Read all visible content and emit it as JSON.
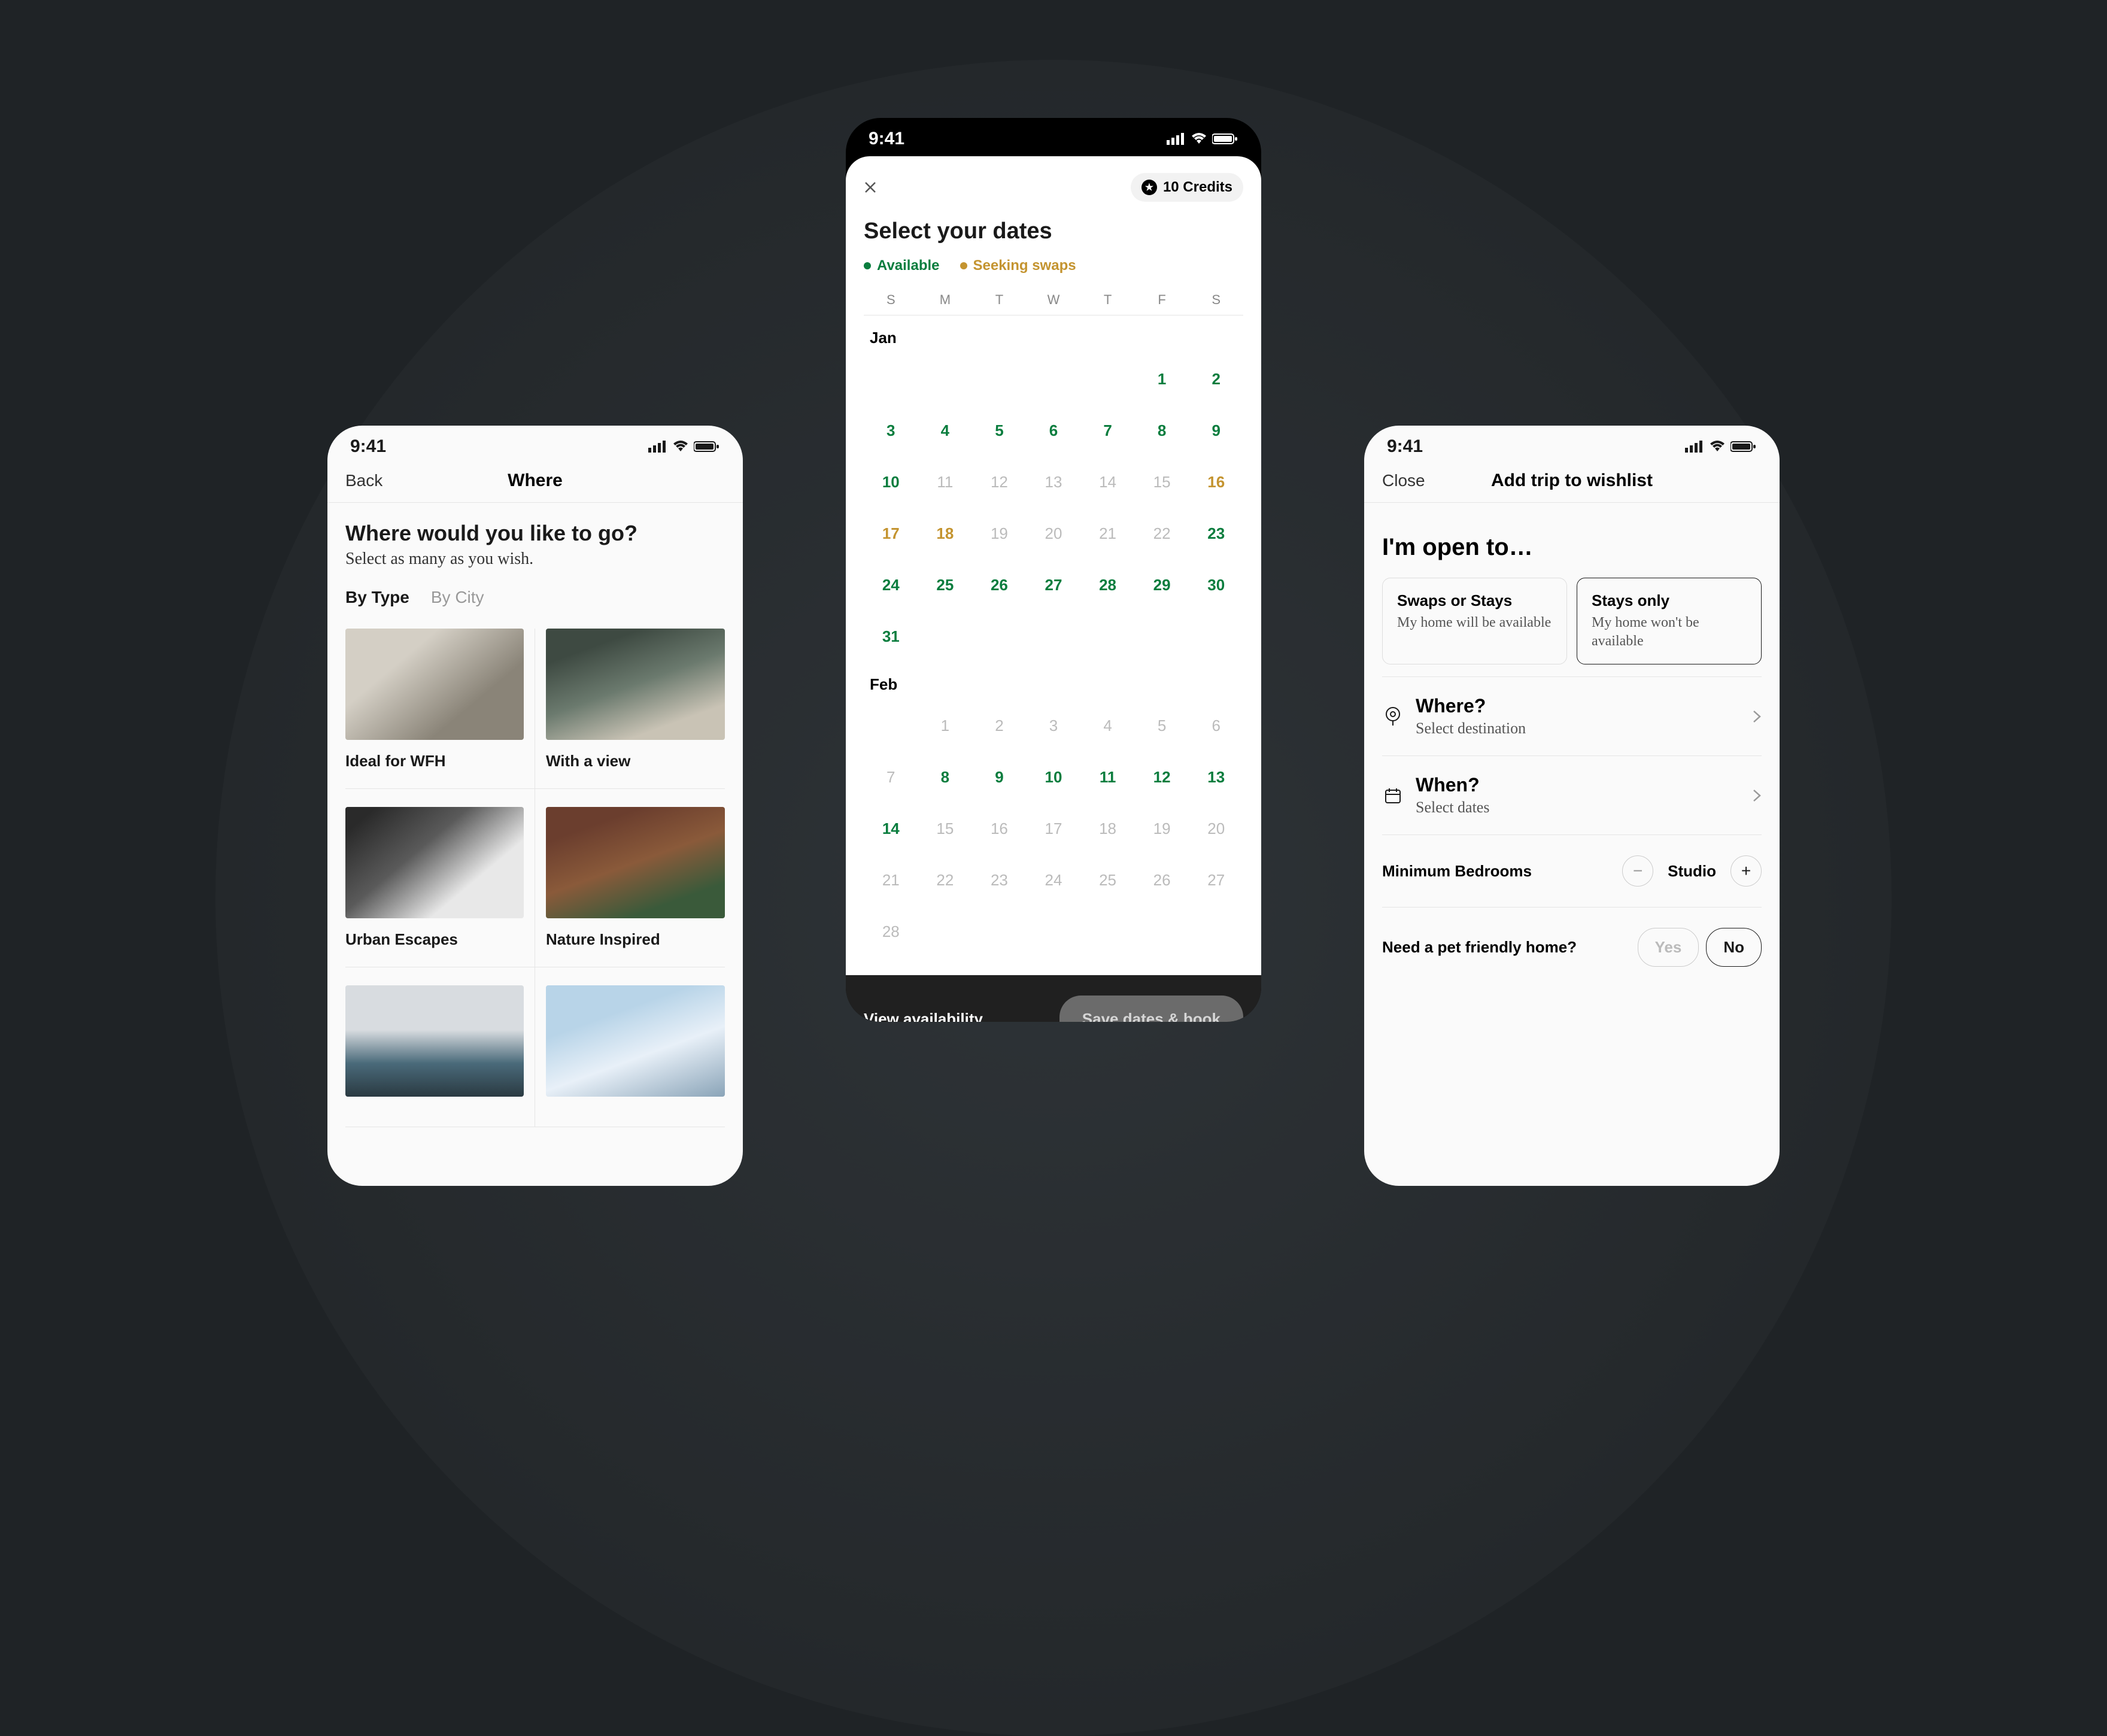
{
  "status_time": "9:41",
  "left": {
    "nav_back": "Back",
    "nav_title": "Where",
    "heading": "Where would you like to go?",
    "subheading": "Select as many as you wish.",
    "tabs": [
      {
        "label": "By Type",
        "active": true
      },
      {
        "label": "By City",
        "active": false
      }
    ],
    "cards": [
      {
        "label": "Ideal for WFH",
        "thumb": "t1"
      },
      {
        "label": "With a view",
        "thumb": "t2"
      },
      {
        "label": "Urban Escapes",
        "thumb": "t3"
      },
      {
        "label": "Nature Inspired",
        "thumb": "t4"
      },
      {
        "label": "",
        "thumb": "t5"
      },
      {
        "label": "",
        "thumb": "t6"
      }
    ]
  },
  "center": {
    "credits_label": "10 Credits",
    "title": "Select your dates",
    "legend": [
      {
        "label": "Available",
        "color": "green"
      },
      {
        "label": "Seeking swaps",
        "color": "amber"
      }
    ],
    "weekdays": [
      "S",
      "M",
      "T",
      "W",
      "T",
      "F",
      "S"
    ],
    "months": [
      {
        "name": "Jan",
        "offset": 5,
        "days": [
          {
            "d": 1,
            "c": "green"
          },
          {
            "d": 2,
            "c": "green"
          },
          {
            "d": 3,
            "c": "green"
          },
          {
            "d": 4,
            "c": "green"
          },
          {
            "d": 5,
            "c": "green"
          },
          {
            "d": 6,
            "c": "green"
          },
          {
            "d": 7,
            "c": "green"
          },
          {
            "d": 8,
            "c": "green"
          },
          {
            "d": 9,
            "c": "green"
          },
          {
            "d": 10,
            "c": "green"
          },
          {
            "d": 11,
            "c": "grey"
          },
          {
            "d": 12,
            "c": "grey"
          },
          {
            "d": 13,
            "c": "grey"
          },
          {
            "d": 14,
            "c": "grey"
          },
          {
            "d": 15,
            "c": "grey"
          },
          {
            "d": 16,
            "c": "amber"
          },
          {
            "d": 17,
            "c": "amber"
          },
          {
            "d": 18,
            "c": "amber"
          },
          {
            "d": 19,
            "c": "grey"
          },
          {
            "d": 20,
            "c": "grey"
          },
          {
            "d": 21,
            "c": "grey"
          },
          {
            "d": 22,
            "c": "grey"
          },
          {
            "d": 23,
            "c": "green"
          },
          {
            "d": 24,
            "c": "green"
          },
          {
            "d": 25,
            "c": "green"
          },
          {
            "d": 26,
            "c": "green"
          },
          {
            "d": 27,
            "c": "green"
          },
          {
            "d": 28,
            "c": "green"
          },
          {
            "d": 29,
            "c": "green"
          },
          {
            "d": 30,
            "c": "green"
          },
          {
            "d": 31,
            "c": "green"
          }
        ]
      },
      {
        "name": "Feb",
        "offset": 1,
        "days": [
          {
            "d": 1,
            "c": "grey"
          },
          {
            "d": 2,
            "c": "grey"
          },
          {
            "d": 3,
            "c": "grey"
          },
          {
            "d": 4,
            "c": "grey"
          },
          {
            "d": 5,
            "c": "grey"
          },
          {
            "d": 6,
            "c": "grey"
          },
          {
            "d": 7,
            "c": "grey"
          },
          {
            "d": 8,
            "c": "green"
          },
          {
            "d": 9,
            "c": "green"
          },
          {
            "d": 10,
            "c": "green"
          },
          {
            "d": 11,
            "c": "green"
          },
          {
            "d": 12,
            "c": "green"
          },
          {
            "d": 13,
            "c": "green"
          },
          {
            "d": 14,
            "c": "green"
          },
          {
            "d": 15,
            "c": "grey"
          },
          {
            "d": 16,
            "c": "grey"
          },
          {
            "d": 17,
            "c": "grey"
          },
          {
            "d": 18,
            "c": "grey"
          },
          {
            "d": 19,
            "c": "grey"
          },
          {
            "d": 20,
            "c": "grey"
          },
          {
            "d": 21,
            "c": "grey"
          },
          {
            "d": 22,
            "c": "grey"
          },
          {
            "d": 23,
            "c": "grey"
          },
          {
            "d": 24,
            "c": "grey"
          },
          {
            "d": 25,
            "c": "grey"
          },
          {
            "d": 26,
            "c": "grey"
          },
          {
            "d": 27,
            "c": "grey"
          },
          {
            "d": 28,
            "c": "grey"
          }
        ]
      }
    ],
    "view_availability": "View availability",
    "save_button": "Save dates & book"
  },
  "right": {
    "close": "Close",
    "nav_title": "Add trip to wishlist",
    "heading": "I'm open to…",
    "options": [
      {
        "title": "Swaps or Stays",
        "sub": "My home will be available",
        "selected": false
      },
      {
        "title": "Stays only",
        "sub": "My home won't be available",
        "selected": true
      }
    ],
    "where": {
      "title": "Where?",
      "sub": "Select destination"
    },
    "when": {
      "title": "When?",
      "sub": "Select dates"
    },
    "bedrooms": {
      "label": "Minimum Bedrooms",
      "value": "Studio"
    },
    "pet": {
      "label": "Need a pet friendly home?",
      "yes": "Yes",
      "no": "No",
      "selected": "No"
    }
  }
}
